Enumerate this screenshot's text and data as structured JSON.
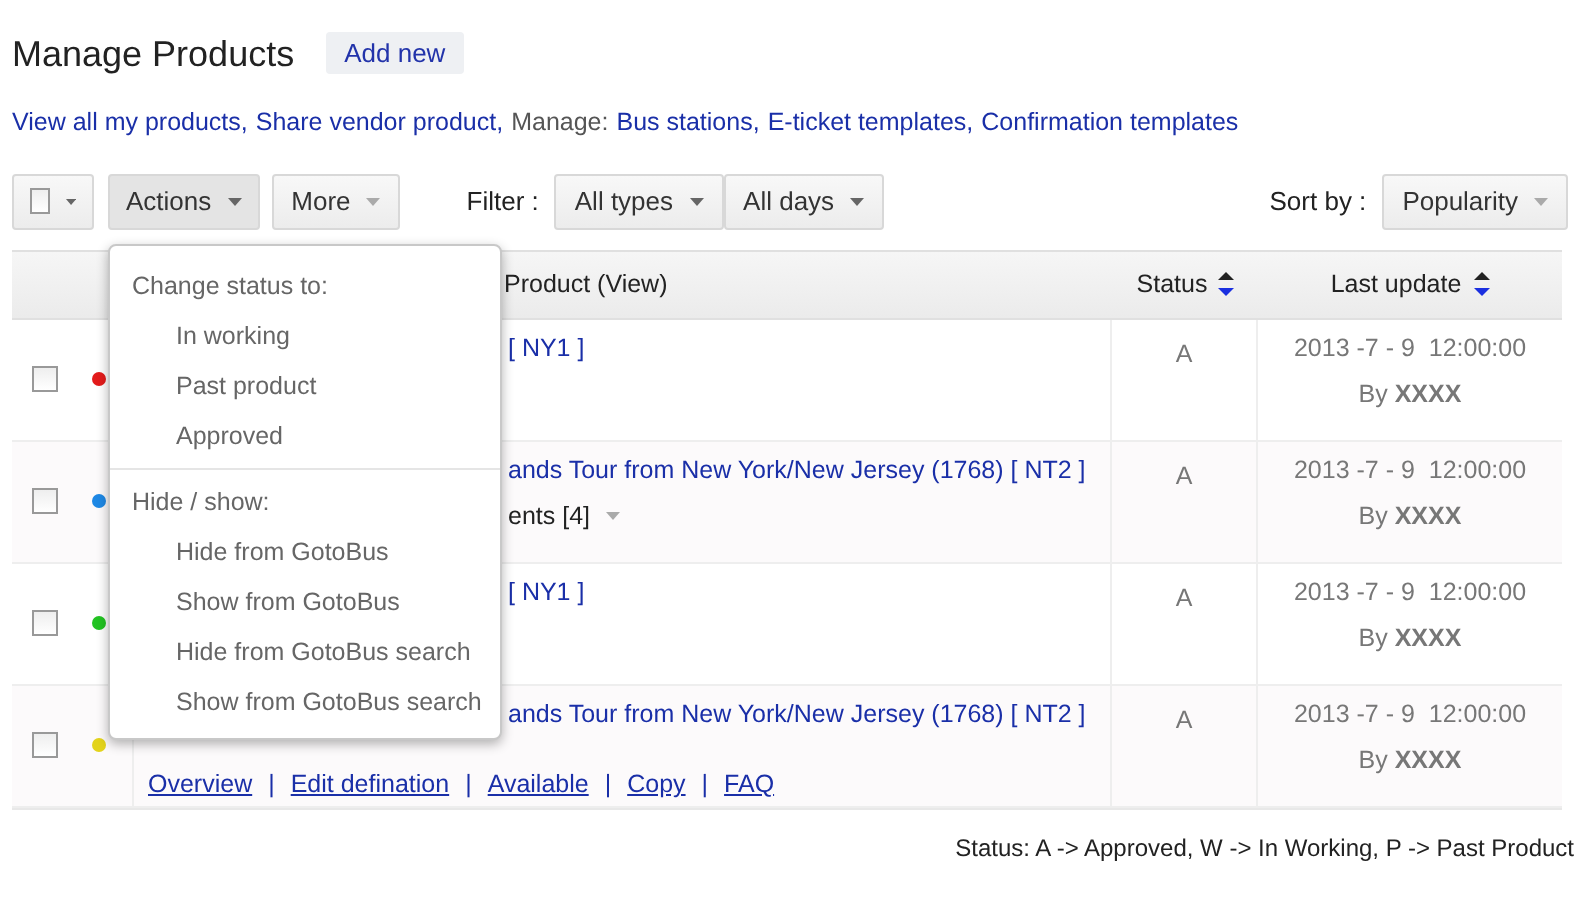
{
  "title": "Manage Products",
  "add_button": "Add new",
  "links": [
    {
      "kind": "link",
      "text": "View all my products,"
    },
    {
      "kind": "link",
      "text": "Share vendor product,"
    },
    {
      "kind": "label",
      "text": "Manage:"
    },
    {
      "kind": "link",
      "text": "Bus stations,"
    },
    {
      "kind": "link",
      "text": "E-ticket templates,"
    },
    {
      "kind": "link",
      "text": "Confirmation templates"
    }
  ],
  "toolbar": {
    "select_all_checked": false,
    "actions": {
      "label": "Actions",
      "expanded": true
    },
    "more": {
      "label": "More",
      "expanded": false
    },
    "filter_label": "Filter :",
    "filters": [
      "All types",
      "All days"
    ],
    "sort_label": "Sort by :",
    "sort": "Popularity"
  },
  "table": {
    "columns": [
      "Product (View)",
      "Status",
      "Last update"
    ],
    "rows": [
      {
        "checked": false,
        "color": "#e31b1b",
        "product": "[ NY1 ]",
        "status": "A",
        "date": "2013 -7 - 9  12:00:00",
        "by": "By **XXXX**"
      },
      {
        "checked": false,
        "color": "#1e88e5",
        "product": "ands Tour from New York/New Jersey (1768) [ NT2 ]",
        "extra": "ents [4]",
        "status": "A",
        "date": "2013 -7 - 9  12:00:00",
        "by": "By **XXXX**"
      },
      {
        "checked": false,
        "color": "#22c322",
        "product": "[ NY1 ]",
        "status": "A",
        "date": "2013 -7 - 9  12:00:00",
        "by": "By **XXXX**"
      },
      {
        "checked": false,
        "color": "#e3d31b",
        "product": "ands Tour from New York/New Jersey (1768) [ NT2 ]",
        "actions": [
          "Overview",
          "Edit defination",
          "Available",
          "Copy",
          "FAQ"
        ],
        "separator": "|",
        "status": "A",
        "date": "2013 -7 - 9  12:00:00",
        "by": "By **XXXX**"
      }
    ]
  },
  "menu": {
    "sections": [
      {
        "heading": "Change status to:",
        "items": [
          "In working",
          "Past product",
          "Approved"
        ]
      },
      {
        "heading": "Hide / show:",
        "items": [
          "Hide from GotoBus",
          "Show from GotoBus",
          "Hide from GotoBus search",
          "Show from GotoBus search"
        ]
      }
    ]
  },
  "legend": "Status: A -> Approved, W -> In Working, P -> Past Product"
}
